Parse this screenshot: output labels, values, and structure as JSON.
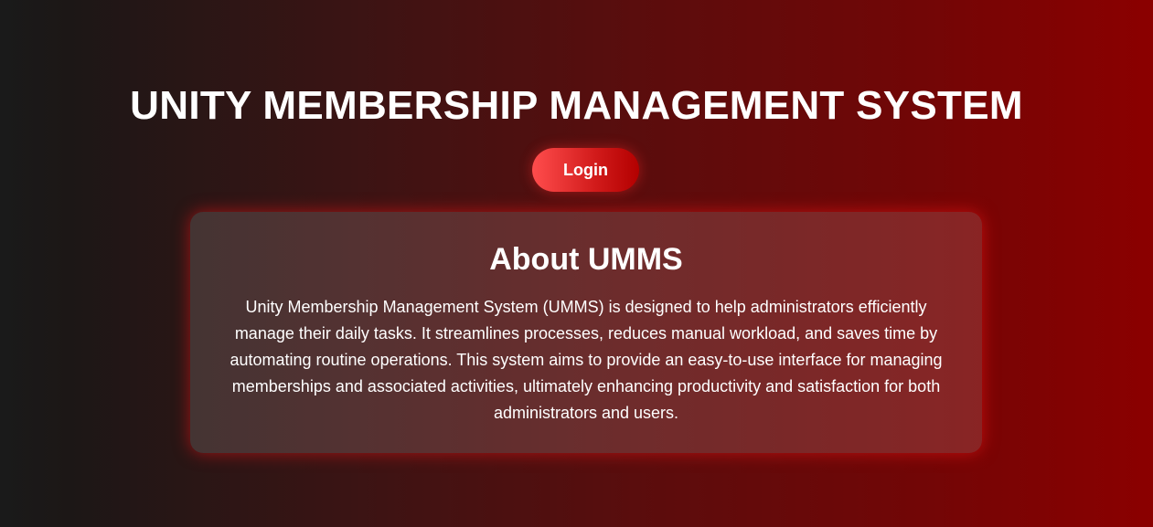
{
  "header": {
    "title": "UNITY MEMBERSHIP MANAGEMENT SYSTEM",
    "login_label": "Login"
  },
  "about": {
    "heading": "About UMMS",
    "body": "Unity Membership Management System (UMMS) is designed to help administrators efficiently manage their daily tasks. It streamlines processes, reduces manual workload, and saves time by automating routine operations. This system aims to provide an easy-to-use interface for managing memberships and associated activities, ultimately enhancing productivity and satisfaction for both administrators and users."
  },
  "colors": {
    "background_start": "#1a1a1a",
    "background_end": "#8b0000",
    "accent": "#ff4d4d"
  }
}
